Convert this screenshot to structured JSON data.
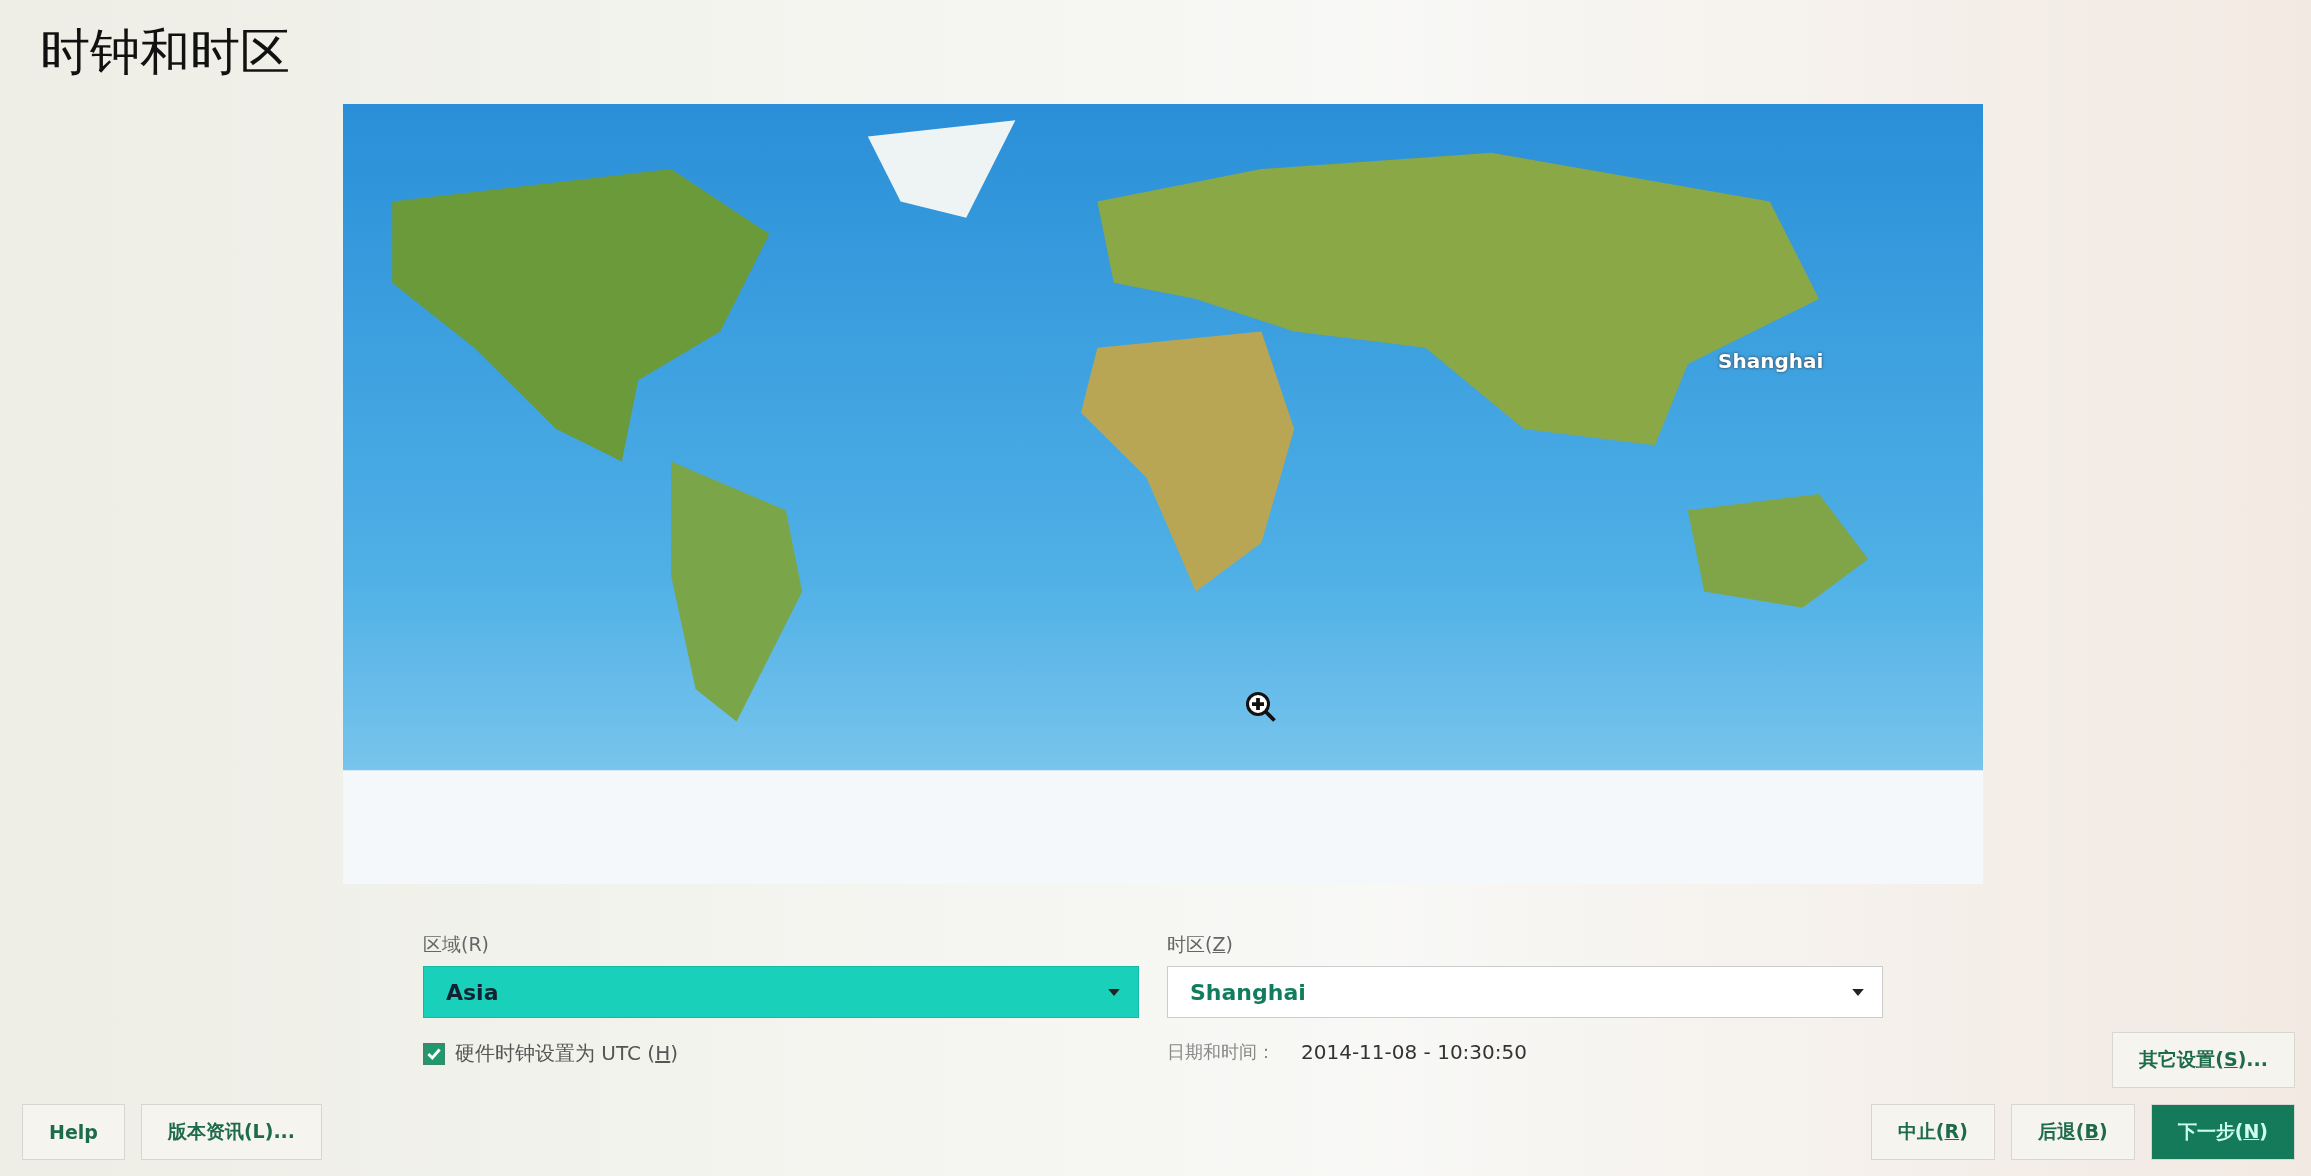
{
  "title": "时钟和时区",
  "map": {
    "marker_label": "Shanghai"
  },
  "region": {
    "label": "区域(R)",
    "value": "Asia",
    "focused": true
  },
  "timezone": {
    "label": {
      "before": "时区(",
      "mnemonic": "Z",
      "after": ")"
    },
    "value": "Shanghai",
    "focused": false
  },
  "hardware_clock": {
    "label": {
      "before": "硬件时钟设置为 UTC (",
      "mnemonic": "H",
      "after": ")"
    },
    "checked": true
  },
  "datetime": {
    "label": "日期和时间：",
    "value": "2014-11-08 - 10:30:50"
  },
  "other_settings": {
    "before": "其它设置(",
    "mnemonic": "S",
    "after": ")..."
  },
  "left_buttons": [
    "Help",
    "版本资讯(L)..."
  ],
  "right_buttons": [
    {
      "label": {
        "before": "中止(",
        "mnemonic": "R",
        "after": ")"
      },
      "primary": false
    },
    {
      "label": {
        "before": "后退(",
        "mnemonic": "B",
        "after": ")"
      },
      "primary": false
    },
    {
      "label": {
        "before": "下一步(",
        "mnemonic": "N",
        "after": ")"
      },
      "primary": true
    }
  ]
}
